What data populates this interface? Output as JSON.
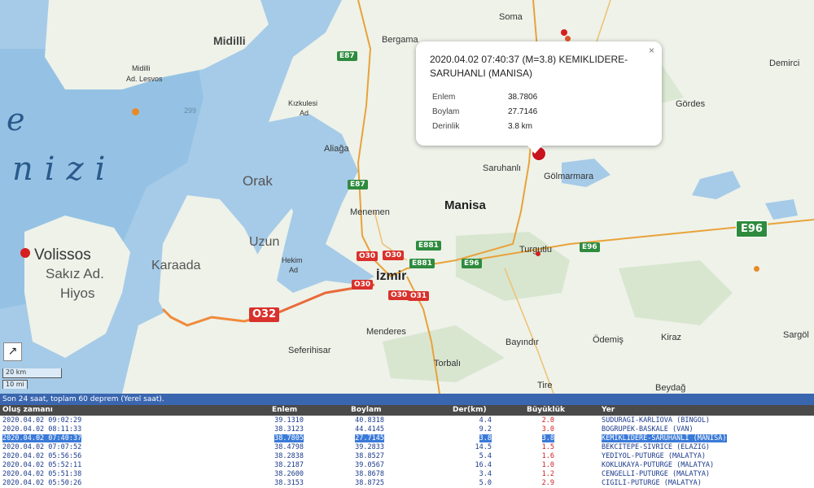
{
  "map": {
    "sea_labels": [
      "e",
      "nizi"
    ],
    "islands": [
      {
        "name": "Midilli",
        "sub": ""
      },
      {
        "name": "Midilli",
        "sub": "Ad. Lesvos"
      },
      {
        "name": "Volissos",
        "sub": ""
      },
      {
        "name": "Sakız Ad.",
        "sub": ""
      },
      {
        "name": "Hiyos",
        "sub": ""
      },
      {
        "name": "Orak",
        "sub": ""
      },
      {
        "name": "Uzun",
        "sub": ""
      },
      {
        "name": "Karaada",
        "sub": ""
      }
    ],
    "cities": [
      "Soma",
      "Bergama",
      "Demirci",
      "Kızkulesi",
      "Ad",
      "Gördes",
      "Aliağa",
      "Saruhanlı",
      "Gölmarmara",
      "Menemen",
      "Manisa",
      "Turgutlu",
      "Hekim",
      "Ad",
      "İzmir",
      "Menderes",
      "Seferihisar",
      "Bayındır",
      "Ödemiş",
      "Kiraz",
      "Sargöl",
      "Torbalı",
      "Tire",
      "Beydağ"
    ],
    "depth_number": "299",
    "roads": [
      "E87",
      "E87",
      "E881",
      "E96",
      "E96",
      "O30",
      "O30",
      "O30",
      "O31",
      "O32",
      "E881"
    ],
    "highway_label": "E96",
    "expand_icon": "↗",
    "scale": {
      "km": "20 km",
      "mi": "10 mi"
    }
  },
  "popup": {
    "title": "2020.04.02 07:40:37 (M=3.8) KEMIKLIDERE-SARUHANLI (MANISA)",
    "close": "×",
    "rows": [
      {
        "label": "Enlem",
        "value": "38.7806"
      },
      {
        "label": "Boylam",
        "value": "27.7146"
      },
      {
        "label": "Derinlik",
        "value": "3.8 km"
      }
    ]
  },
  "status_text": "Son 24 saat, toplam 60 deprem (Yerel saat).",
  "table": {
    "headers": {
      "time": "Oluş zamanı",
      "lat": "Enlem",
      "lon": "Boylam",
      "depth": "Der(km)",
      "mag": "Büyüklük",
      "place": "Yer"
    },
    "rows": [
      {
        "time": "2020.04.02 09:02:29",
        "lat": "39.1310",
        "lon": "40.8318",
        "depth": "4.4",
        "mag": "2.0",
        "place": "SUDURAGI-KARLIOVA (BINGOL)"
      },
      {
        "time": "2020.04.02 08:11:33",
        "lat": "38.3123",
        "lon": "44.4145",
        "depth": "9.2",
        "mag": "3.0",
        "place": "BOGRUPEK-BASKALE (VAN)"
      },
      {
        "time": "2020.04.02 07:40:37",
        "lat": "38.7805",
        "lon": "27.7145",
        "depth": "3.8",
        "mag": "3.8",
        "place": "KEMIKLIDERE-SARUHANLI (MANISA)"
      },
      {
        "time": "2020.04.02 07:07:52",
        "lat": "38.4798",
        "lon": "39.2833",
        "depth": "14.5",
        "mag": "1.5",
        "place": "BEKCITEPE-SIVRICE (ELAZIG)"
      },
      {
        "time": "2020.04.02 05:56:56",
        "lat": "38.2838",
        "lon": "38.8527",
        "depth": "5.4",
        "mag": "1.6",
        "place": "YEDIYOL-PUTURGE (MALATYA)"
      },
      {
        "time": "2020.04.02 05:52:11",
        "lat": "38.2187",
        "lon": "39.0567",
        "depth": "16.4",
        "mag": "1.0",
        "place": "KOKLUKAYA-PUTURGE (MALATYA)"
      },
      {
        "time": "2020.04.02 05:51:38",
        "lat": "38.2600",
        "lon": "38.8678",
        "depth": "3.4",
        "mag": "1.2",
        "place": "CENGELLI-PUTURGE (MALATYA)"
      },
      {
        "time": "2020.04.02 05:50:26",
        "lat": "38.3153",
        "lon": "38.8725",
        "depth": "5.0",
        "mag": "2.9",
        "place": "CIGILI-PUTURGE (MALATYA)"
      }
    ]
  },
  "colors": {
    "sea": "#a6cbe8",
    "deep_sea": "#7fb3df",
    "land": "#eef2e9",
    "status_bar": "#3a66b0",
    "quake_red": "#d51f1f",
    "quake_orange": "#e88a2a",
    "highlight": "#3a7ad8"
  }
}
